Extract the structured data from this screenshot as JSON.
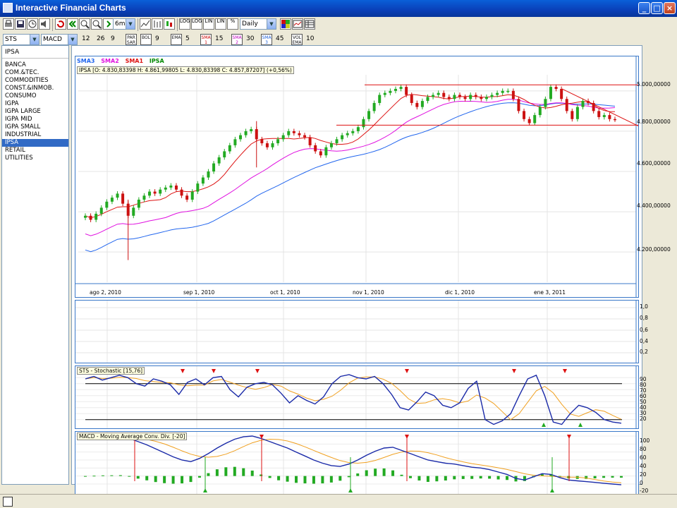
{
  "window": {
    "title": "Interactive Financial Charts"
  },
  "toolbar1": {
    "period": "6m",
    "interval": "Daily",
    "log_labels": [
      "LOG",
      "LOG",
      "LIN",
      "LIN",
      "%"
    ]
  },
  "toolbar2": {
    "symbol_select": "STS",
    "indicator_select": "MACD",
    "macd_params": [
      "12",
      "26",
      "9"
    ],
    "par_sar_label": "PAR SAR",
    "bol_label": "BOL",
    "bol_value": "9",
    "ema_label": "EMA",
    "ema_value": "5",
    "sma1_label": "SMA 1",
    "sma1_value": "15",
    "sma2_label": "SMA 2",
    "sma2_value": "30",
    "sma3_label": "SMA 3",
    "sma3_value": "45",
    "vol_label": "VOL EMA",
    "vol_value": "10"
  },
  "sidebar": {
    "selected_index": "IPSA",
    "items": [
      "BANCA",
      "COM.&TEC.",
      "COMMODITIES",
      "CONST.&INMOB.",
      "CONSUMO",
      "IGPA",
      "IGPA LARGE",
      "IGPA MID",
      "IGPA SMALL",
      "INDUSTRIAL",
      "IPSA",
      "RETAIL",
      "UTILITIES"
    ],
    "selected": "IPSA"
  },
  "price_panel": {
    "legend": [
      "SMA3",
      "SMA2",
      "SMA1",
      "IPSA"
    ],
    "ohlc": "IPSA [O: 4.830,83398  H: 4.861,99805  L: 4.830,83398  C: 4.857,87207] (+0,56%)",
    "y_labels": [
      "5.000,00000",
      "4.800,00000",
      "4.600,00000",
      "4.400,00000",
      "4.200,00000"
    ],
    "x_labels": [
      "ago 2, 2010",
      "sep 1, 2010",
      "oct 1, 2010",
      "nov 1, 2010",
      "dic 1, 2010",
      "ene 3, 2011"
    ]
  },
  "volume_panel": {
    "y_labels": [
      "1,0",
      "0,8",
      "0,6",
      "0,4",
      "0,2"
    ]
  },
  "sts_panel": {
    "title": "STS - Stochastic [15,76]",
    "y_labels": [
      "90",
      "80",
      "70",
      "60",
      "50",
      "40",
      "30",
      "20"
    ]
  },
  "macd_panel": {
    "title": "MACD - Moving Average Conv. Div. [-20]",
    "y_labels": [
      "100",
      "80",
      "60",
      "40",
      "20",
      "0",
      "-20"
    ]
  },
  "colors": {
    "sma1": "#dd1111",
    "sma2": "#e010e0",
    "sma3": "#2266ee",
    "ipsa": "#008800",
    "up_candle": "#22aa22",
    "down_candle": "#cc1111",
    "panel_border": "#3a78c8"
  },
  "chart_data": {
    "type": "candlestick",
    "symbol": "IPSA",
    "x_range": [
      "2010-07-26",
      "2011-01-31"
    ],
    "y_range": [
      4050,
      5080
    ],
    "close_series": [
      4380,
      4360,
      4390,
      4420,
      4450,
      4470,
      4490,
      4440,
      4380,
      4420,
      4460,
      4480,
      4500,
      4490,
      4510,
      4520,
      4530,
      4510,
      4480,
      4460,
      4500,
      4540,
      4570,
      4600,
      4640,
      4670,
      4700,
      4730,
      4760,
      4780,
      4800,
      4810,
      4760,
      4740,
      4720,
      4740,
      4760,
      4780,
      4800,
      4790,
      4780,
      4770,
      4730,
      4700,
      4680,
      4720,
      4740,
      4760,
      4780,
      4790,
      4800,
      4820,
      4860,
      4900,
      4940,
      4980,
      4990,
      5000,
      5010,
      5020,
      4980,
      4940,
      4920,
      4950,
      4970,
      4980,
      4990,
      4970,
      4960,
      4980,
      4970,
      4960,
      4980,
      4970,
      4960,
      4970,
      4980,
      4990,
      5000,
      5000,
      4960,
      4900,
      4860,
      4840,
      4880,
      4920,
      4960,
      5020,
      5010,
      4960,
      4900,
      4860,
      4920,
      4950,
      4940,
      4900,
      4870,
      4880,
      4860,
      4857.87
    ],
    "resistance_level": 5030,
    "support_level": 4830,
    "ohlc_last": {
      "open": 4830.83398,
      "high": 4861.99805,
      "low": 4830.83398,
      "close": 4857.87207,
      "change_pct": 0.56
    }
  }
}
